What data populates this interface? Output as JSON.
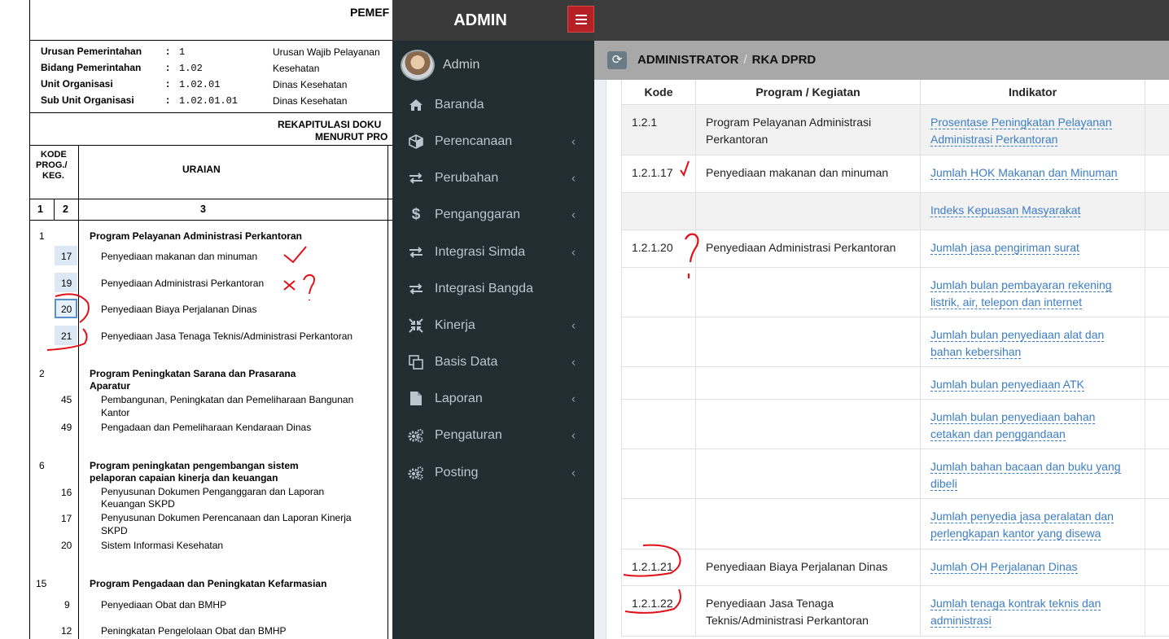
{
  "document": {
    "header_title": "PEMEF",
    "info": [
      {
        "label": "Urusan Pemerintahan",
        "code": "1",
        "desc": "Urusan Wajib Pelayanan"
      },
      {
        "label": "Bidang Pemerintahan",
        "code": "1.02",
        "desc": "Kesehatan"
      },
      {
        "label": "Unit Organisasi",
        "code": "1.02.01",
        "desc": "Dinas Kesehatan"
      },
      {
        "label": "Sub Unit Organisasi",
        "code": "1.02.01.01",
        "desc": "Dinas Kesehatan"
      }
    ],
    "colon": ":",
    "rekap_line1": "REKAPITULASI DOKU",
    "rekap_line2": "MENURUT PRO",
    "col_kode_line1": "KODE",
    "col_kode_line2": "PROG./",
    "col_kode_line3": "KEG.",
    "col_uraian": "URAIAN",
    "col_num1": "1",
    "col_num2": "2",
    "col_num3": "3",
    "rows": {
      "p1": "1",
      "p1_title": "Program Pelayanan Administrasi Perkantoran",
      "k17": "17",
      "k17_text": "Penyediaan makanan dan minuman",
      "k19": "19",
      "k19_text": "Penyediaan Administrasi Perkantoran",
      "k20": "20",
      "k20_text": "Penyediaan Biaya Perjalanan Dinas",
      "k21": "21",
      "k21_text": "Penyediaan Jasa Tenaga Teknis/Administrasi Perkantoran",
      "p2": "2",
      "p2_title_l1": "Program Peningkatan Sarana dan Prasarana",
      "p2_title_l2": "Aparatur",
      "k45": "45",
      "k45_text_l1": "Pembangunan, Peningkatan dan Pemeliharaan Bangunan",
      "k45_text_l2": "Kantor",
      "k49": "49",
      "k49_text": "Pengadaan dan Pemeliharaan Kendaraan Dinas",
      "p6": "6",
      "p6_title_l1": "Program peningkatan pengembangan sistem",
      "p6_title_l2": "pelaporan capaian kinerja dan keuangan",
      "k16": "16",
      "k16_text_l1": "Penyusunan Dokumen Penganggaran dan Laporan",
      "k16_text_l2": "Keuangan SKPD",
      "k17b": "17",
      "k17b_text_l1": "Penyusunan Dokumen Perencanaan dan Laporan Kinerja",
      "k17b_text_l2": "SKPD",
      "k20b": "20",
      "k20b_text": "Sistem Informasi Kesehatan",
      "p15": "15",
      "p15_title": "Program Pengadaan dan Peningkatan Kefarmasian",
      "k9": "9",
      "k9_text": "Penyediaan Obat dan BMHP",
      "k12": "12",
      "k12_text": "Peningkatan Pengelolaan Obat dan BMHP"
    }
  },
  "app": {
    "brand": "ADMIN",
    "user_name": "Admin",
    "nav": [
      {
        "label": "Baranda",
        "icon": "home-icon",
        "has_children": false
      },
      {
        "label": "Perencanaan",
        "icon": "cube-icon",
        "has_children": true
      },
      {
        "label": "Perubahan",
        "icon": "exchange-icon",
        "has_children": true
      },
      {
        "label": "Penganggaran",
        "icon": "dollar-icon",
        "has_children": true
      },
      {
        "label": "Integrasi Simda",
        "icon": "exchange-icon",
        "has_children": true
      },
      {
        "label": "Integrasi Bangda",
        "icon": "exchange-icon",
        "has_children": false
      },
      {
        "label": "Kinerja",
        "icon": "compress-icon",
        "has_children": true
      },
      {
        "label": "Basis Data",
        "icon": "clone-icon",
        "has_children": true
      },
      {
        "label": "Laporan",
        "icon": "file-icon",
        "has_children": true
      },
      {
        "label": "Pengaturan",
        "icon": "gears-icon",
        "has_children": true
      },
      {
        "label": "Posting",
        "icon": "gears-icon",
        "has_children": true
      }
    ],
    "chevron": "‹",
    "breadcrumb": [
      "ADMINISTRATOR",
      "RKA DPRD"
    ],
    "breadcrumb_sep": "/",
    "table": {
      "headers": [
        "Kode",
        "Program / Kegiatan",
        "Indikator"
      ],
      "rows": [
        {
          "kode": "1.2.1",
          "program": "Program Pelayanan Administrasi Perkantoran",
          "indikator": "Prosentase Peningkatan Pelayanan Administrasi Perkantoran",
          "grey": true
        },
        {
          "kode": "1.2.1.17",
          "program": "Penyediaan makanan dan minuman",
          "indikator": "Jumlah HOK Makanan dan Minuman",
          "grey": false
        },
        {
          "kode": "",
          "program": "",
          "indikator": "Indeks Kepuasan Masyarakat",
          "grey": true
        },
        {
          "kode": "1.2.1.20",
          "program": "Penyediaan Administrasi Perkantoran",
          "indikator": "Jumlah jasa pengiriman surat",
          "grey": false
        },
        {
          "kode": "",
          "program": "",
          "indikator": "Jumlah bulan pembayaran rekening listrik, air, telepon dan internet",
          "grey": false
        },
        {
          "kode": "",
          "program": "",
          "indikator": "Jumlah bulan penyediaan alat dan bahan kebersihan",
          "grey": false
        },
        {
          "kode": "",
          "program": "",
          "indikator": "Jumlah bulan penyediaan ATK",
          "grey": false
        },
        {
          "kode": "",
          "program": "",
          "indikator": "Jumlah bulan penyediaan bahan cetakan dan penggandaan",
          "grey": false
        },
        {
          "kode": "",
          "program": "",
          "indikator": "Jumlah bahan bacaan dan buku yang dibeli",
          "grey": false
        },
        {
          "kode": "",
          "program": "",
          "indikator": "Jumlah penyedia jasa peralatan dan perlengkapan kantor yang disewa",
          "grey": false
        },
        {
          "kode": "1.2.1.21",
          "program": "Penyediaan Biaya Perjalanan Dinas",
          "indikator": "Jumlah OH Perjalanan Dinas",
          "grey": false
        },
        {
          "kode": "1.2.1.22",
          "program": "Penyediaan Jasa Tenaga Teknis/Administrasi Perkantoran",
          "indikator": "Jumlah tenaga kontrak teknis dan administrasi",
          "grey": false
        }
      ]
    }
  },
  "colors": {
    "sidebar_bg": "#222d32",
    "topbar_bg": "#3a3a3a",
    "toggle_red": "#b52025",
    "link_blue": "#3c7dc4",
    "ink_red": "#e0101a"
  }
}
